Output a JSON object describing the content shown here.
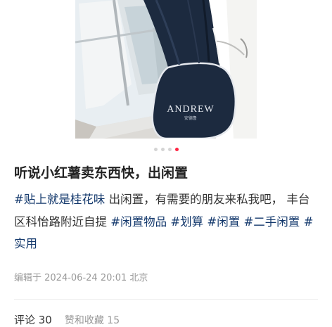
{
  "post": {
    "image": {
      "brand_text": "ANDREW",
      "brand_sub": "安德鲁"
    },
    "carousel": {
      "count": 4,
      "active": 3
    },
    "title": "听说小红薯卖东西快，出闲置",
    "body": {
      "tag1": "#贴上就是桂花味",
      "text1": " 出闲置，有需要的朋友来私我吧， 丰台区科怡路附近自提 ",
      "tag2": "#闲置物品",
      "tag3": "#划算",
      "tag4": "#闲置",
      "tag5": "#二手闲置",
      "tag6": "#实用"
    },
    "meta": "编辑于 2024-06-24 20:01 北京",
    "footer": {
      "comments": "评论 30",
      "likes": "赞和收藏 15"
    }
  },
  "colors": {
    "accent": "#ff2442",
    "tag": "#13386c"
  }
}
